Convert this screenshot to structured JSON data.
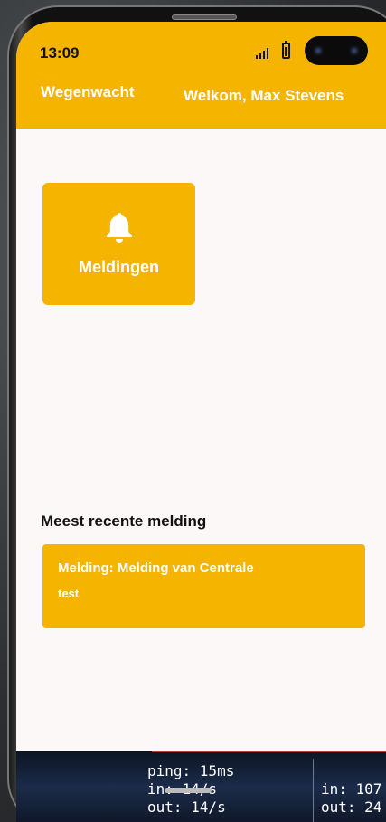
{
  "status_bar": {
    "time": "13:09"
  },
  "app_bar": {
    "title": "Wegenwacht",
    "welcome": "Welkom, Max Stevens"
  },
  "tiles": [
    {
      "label": "Meldingen",
      "icon": "bell-icon"
    }
  ],
  "recent": {
    "section_title": "Meest recente melding",
    "card_title": "Melding: Melding van Centrale",
    "card_body": "test"
  },
  "debug_overlay": {
    "left": [
      "ping: 15ms",
      "in: 14/s",
      "out: 14/s"
    ],
    "right": [
      "in: 107",
      "out: 24"
    ]
  },
  "colors": {
    "accent": "#f5b400",
    "background": "#fcf8f7"
  }
}
